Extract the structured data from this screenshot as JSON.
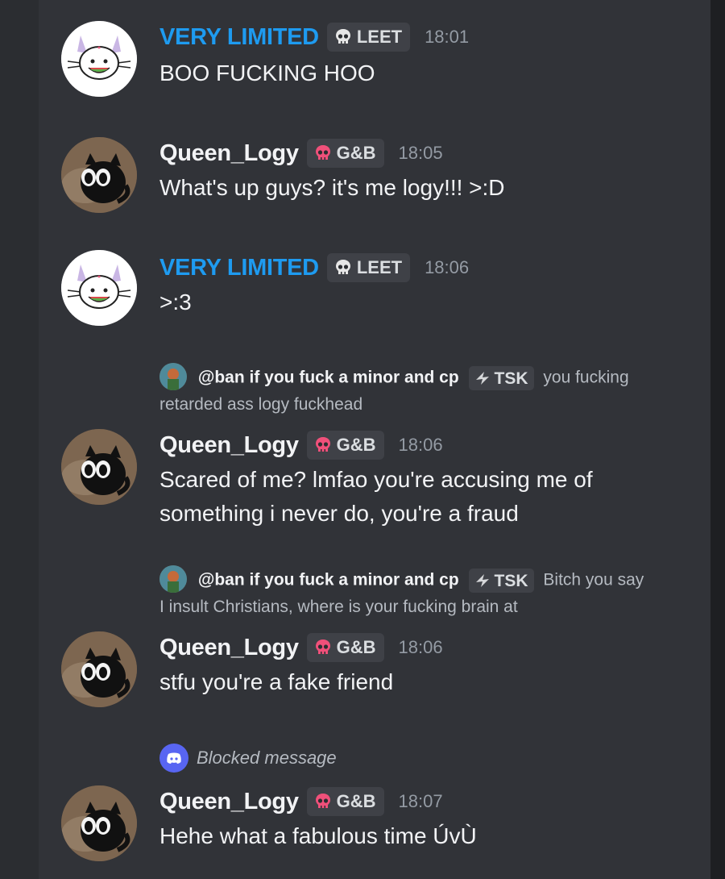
{
  "messages": [
    {
      "type": "message",
      "username": "VERY LIMITED",
      "tag": "LEET",
      "tag_icon": "skull-icon",
      "time": "18:01",
      "text": "BOO FUCKING HOO",
      "avatar": "white-cat-avatar"
    },
    {
      "type": "message",
      "username": "Queen_Logy",
      "tag": "G&B",
      "tag_icon": "red-skull-icon",
      "time": "18:05",
      "text": "What's up guys? it's me logy!!! >:D",
      "avatar": "black-cat-avatar"
    },
    {
      "type": "message",
      "username": "VERY LIMITED",
      "tag": "LEET",
      "tag_icon": "skull-icon",
      "time": "18:06",
      "text": ">:3",
      "avatar": "white-cat-avatar"
    },
    {
      "type": "reply",
      "reply_to": "@ban if you fuck a minor and cp",
      "reply_tag": "TSK",
      "reply_text": "you fucking retarded ass logy fuckhead",
      "username": "Queen_Logy",
      "tag": "G&B",
      "time": "18:06",
      "text": "Scared of me? lmfao you're accusing me of something i never do, you're a fraud"
    },
    {
      "type": "reply",
      "reply_to": "@ban if you fuck a minor and cp",
      "reply_tag": "TSK",
      "reply_text": "Bitch you say I insult Christians, where is your fucking brain at",
      "username": "Queen_Logy",
      "tag": "G&B",
      "time": "18:06",
      "text": "stfu you're a fake friend"
    },
    {
      "type": "blocked",
      "label": "Blocked message",
      "username": "Queen_Logy",
      "tag": "G&B",
      "time": "18:07",
      "text": "Hehe what a fabulous time ÚvÙ"
    }
  ],
  "colors": {
    "background": "#313338",
    "username_blue": "#1e9bf0",
    "timestamp": "#949ba4",
    "blurple": "#5865f2"
  }
}
